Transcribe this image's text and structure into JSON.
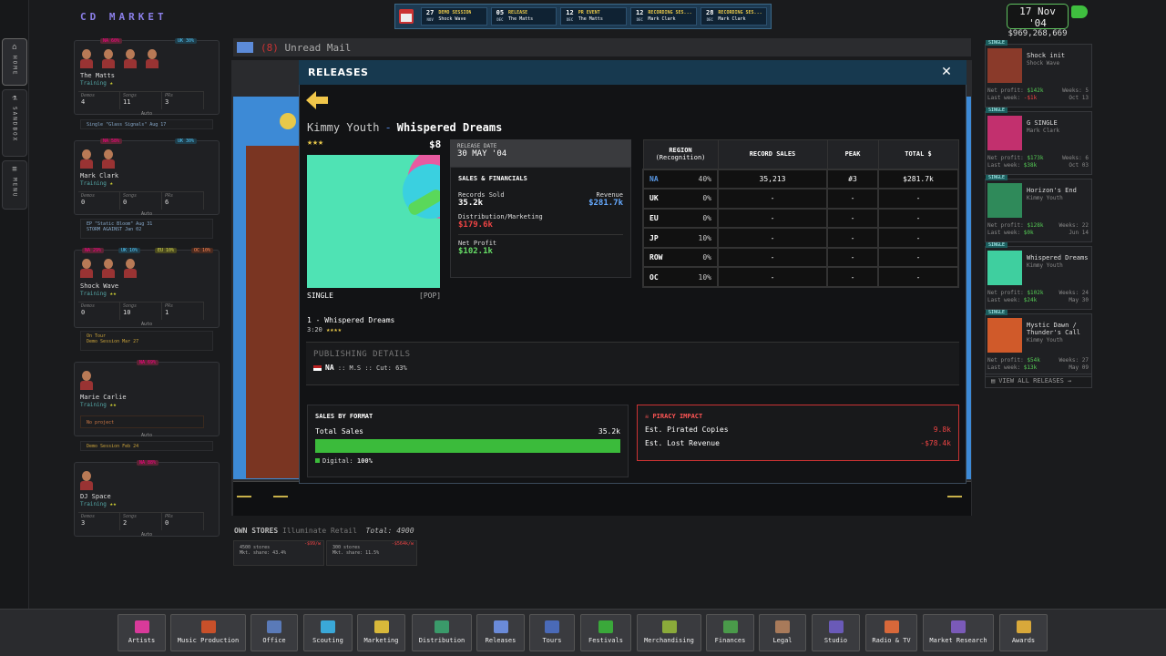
{
  "app": {
    "brand": "CD MARKET",
    "date": "17 Nov '04",
    "money": "$969,268,669"
  },
  "leftnav": [
    "HOME",
    "SANDBOX",
    "MENU"
  ],
  "calendar": [
    {
      "day": "27",
      "month": "NOV",
      "type": "DEMO SESSION",
      "who": "Shock Wave"
    },
    {
      "day": "05",
      "month": "DEC",
      "type": "RELEASE",
      "who": "The Matts"
    },
    {
      "day": "12",
      "month": "DEC",
      "type": "PR EVENT",
      "who": "The Matts"
    },
    {
      "day": "12",
      "month": "DEC",
      "type": "RECORDING SES...",
      "who": "Mark Clark"
    },
    {
      "day": "28",
      "month": "DEC",
      "type": "RECORDING SES...",
      "who": "Mark Clark"
    }
  ],
  "mail": {
    "count": "(8)",
    "label": "Unread Mail"
  },
  "artists": [
    {
      "name": "The Matts",
      "status": "Training",
      "demos": "4",
      "songs": "11",
      "prs": "3",
      "region_l": "NA 60%",
      "region_r": "UK 30%",
      "note": "Single \"Glass Signals\" Aug 17",
      "auto": "Auto"
    },
    {
      "name": "Mark Clark",
      "status": "Training",
      "demos": "0",
      "songs": "0",
      "prs": "6",
      "region_l": "NA 58%",
      "region_r": "UK 30%",
      "note": "EP \"Static Bloom\" Aug 31",
      "note2": "STORM AGAINST Jan 02",
      "auto": "Auto"
    },
    {
      "name": "Shock Wave",
      "status": "Training",
      "demos": "0",
      "songs": "10",
      "prs": "1",
      "region_l": "NA 29%",
      "region_m1": "UK 10%",
      "region_m2": "EU 10%",
      "region_r": "OC 10%",
      "note": "On Tour",
      "note2": "Demo Session Mar 27",
      "auto": "Auto"
    },
    {
      "name": "Marie Carlie",
      "status": "Training",
      "region_r": "NA 69%",
      "note": "No project",
      "note2": "Demo Session Feb 24",
      "auto": "Auto"
    },
    {
      "name": "DJ Space",
      "status": "Training",
      "demos": "3",
      "songs": "2",
      "prs": "0",
      "region_r": "NA 88%",
      "auto": "Auto"
    }
  ],
  "stat_labels": {
    "demos": "Demos",
    "songs": "Songs",
    "prs": "PRs"
  },
  "own_stores": {
    "title": "OWN STORES",
    "company": "Illuminate Retail",
    "total": "Total: 4900",
    "cards": [
      {
        "stores": "4500 stores",
        "share": "Mkt. share: 43.4%",
        "tag": "-$99/w"
      },
      {
        "stores": "300 stores",
        "share": "Mkt. share: 11.5%",
        "tag": "-$564k/w"
      }
    ]
  },
  "releases_list": [
    {
      "tag": "SINGLE",
      "title": "Shock init",
      "artist": "Shock Wave",
      "net": "$142k",
      "last": "-$1k",
      "weeks": "5",
      "date": "Oct 13"
    },
    {
      "tag": "SINGLE",
      "title": "G SINGLE",
      "artist": "Mark Clark",
      "net": "$173k",
      "last": "$38k",
      "weeks": "6",
      "date": "Oct 03"
    },
    {
      "tag": "SINGLE",
      "title": "Horizon's End",
      "artist": "Kimmy Youth",
      "net": "$128k",
      "last": "$0k",
      "weeks": "22",
      "date": "Jun 14"
    },
    {
      "tag": "SINGLE",
      "title": "Whispered Dreams",
      "artist": "Kimmy Youth",
      "net": "$102k",
      "last": "$24k",
      "weeks": "24",
      "date": "May 30"
    },
    {
      "tag": "SINGLE",
      "title": "Mystic Dawn / Thunder's Call",
      "artist": "Kimmy Youth",
      "net": "$54k",
      "last": "$13k",
      "weeks": "27",
      "date": "May 09"
    }
  ],
  "releases_labels": {
    "net": "Net profit:",
    "last": "Last week:",
    "weeks": "Weeks:",
    "view_all": "VIEW ALL RELEASES"
  },
  "modal": {
    "title": "RELEASES",
    "artist": "Kimmy Youth",
    "release": "Whispered Dreams",
    "price": "$8",
    "stars": "★★★",
    "format": "SINGLE",
    "genre": "[POP]",
    "release_date_label": "RELEASE DATE",
    "release_date": "30 MAY '04",
    "fin_title": "SALES & FINANCIALS",
    "records_sold_label": "Records Sold",
    "records_sold": "35.2k",
    "revenue_label": "Revenue",
    "revenue": "$281.7k",
    "dist_label": "Distribution/Marketing",
    "dist": "$179.6k",
    "net_label": "Net Profit",
    "net": "$102.1k",
    "table_head": {
      "region": "REGION",
      "recog": "(Recognition)",
      "sales": "RECORD SALES",
      "peak": "PEAK",
      "total": "TOTAL $"
    },
    "regions": [
      {
        "r": "NA",
        "p": "40%",
        "s": "35,213",
        "pk": "#3",
        "t": "$281.7k"
      },
      {
        "r": "UK",
        "p": "0%",
        "s": "-",
        "pk": "-",
        "t": "-"
      },
      {
        "r": "EU",
        "p": "0%",
        "s": "-",
        "pk": "-",
        "t": "-"
      },
      {
        "r": "JP",
        "p": "10%",
        "s": "-",
        "pk": "-",
        "t": "-"
      },
      {
        "r": "ROW",
        "p": "0%",
        "s": "-",
        "pk": "-",
        "t": "-"
      },
      {
        "r": "OC",
        "p": "10%",
        "s": "-",
        "pk": "-",
        "t": "-"
      }
    ],
    "track": "1 - Whispered Dreams",
    "track_len": "3:20",
    "track_stars": "★★★★",
    "pub_title": "PUBLISHING DETAILS",
    "pub_region": "NA",
    "pub_detail": ":: M.S :: Cut: 63%",
    "sbf_title": "SALES BY FORMAT",
    "total_sales_label": "Total Sales",
    "total_sales": "35.2k",
    "digital_label": "Digital:",
    "digital": "100%",
    "digital_fraction": 1.0,
    "pir_title": "PIRACY IMPACT",
    "pir_copies_label": "Est. Pirated Copies",
    "pir_copies": "9.8k",
    "pir_lost_label": "Est. Lost Revenue",
    "pir_lost": "-$78.4k"
  },
  "bottom_nav": [
    "Artists",
    "Music Production",
    "Office",
    "Scouting",
    "Marketing",
    "Distribution",
    "Releases",
    "Tours",
    "Festivals",
    "Merchandising",
    "Finances",
    "Legal",
    "Studio",
    "Radio & TV",
    "Market Research",
    "Awards"
  ]
}
